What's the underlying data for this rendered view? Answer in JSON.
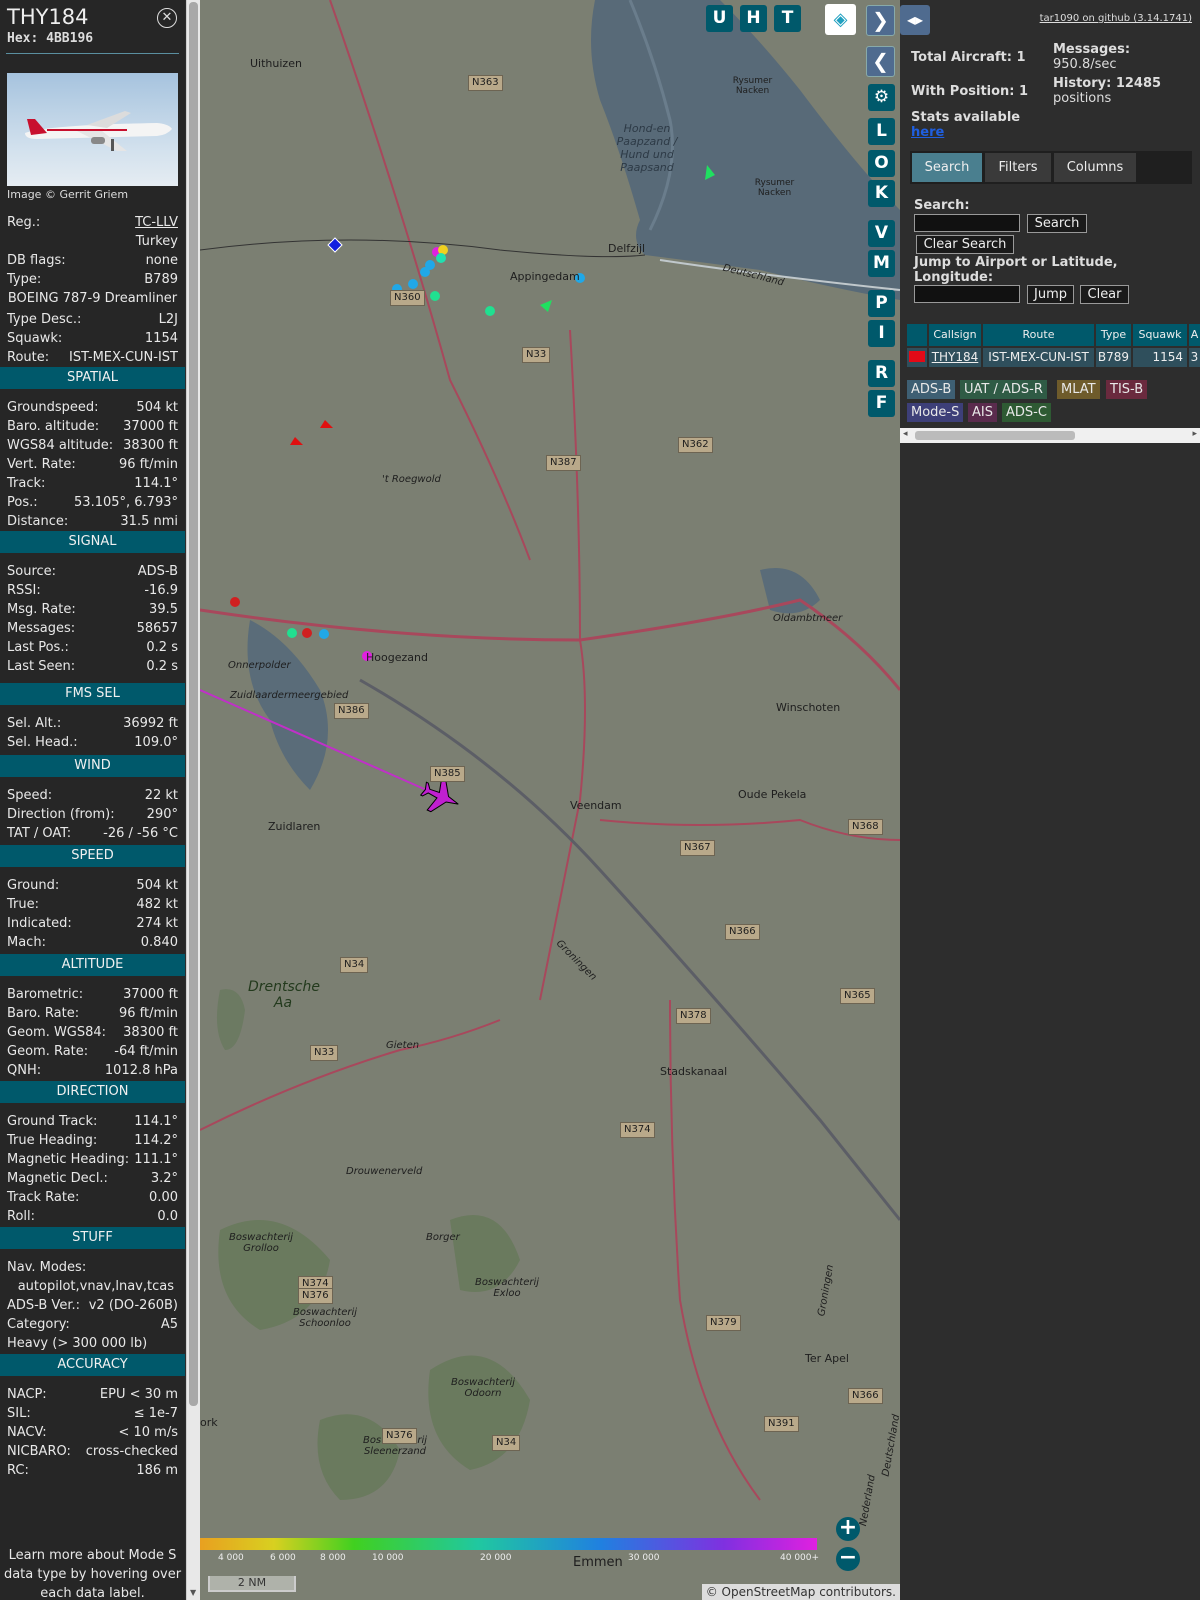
{
  "aircraft": {
    "callsign": "THY184",
    "hex": "Hex: 4BB196",
    "photo_credit": "Image © Gerrit Griem"
  },
  "basic": [
    {
      "k": "Reg.:",
      "v": "TC-LLV"
    },
    {
      "k": "",
      "v": "Turkey"
    },
    {
      "k": "DB flags:",
      "v": "none"
    },
    {
      "k": "Type:",
      "v": "B789"
    },
    {
      "k": "",
      "v": "BOEING 787-9 Dreamliner",
      "full": true
    },
    {
      "k": "Type Desc.:",
      "v": "L2J"
    },
    {
      "k": "Squawk:",
      "v": "1154"
    },
    {
      "k": "Route:",
      "v": "IST-MEX-CUN-IST"
    }
  ],
  "sections": [
    {
      "title": "SPATIAL",
      "rows": [
        {
          "k": "Groundspeed:",
          "v": "504 kt"
        },
        {
          "k": "Baro. altitude:",
          "v": "37000 ft"
        },
        {
          "k": "WGS84 altitude:",
          "v": "38300 ft"
        },
        {
          "k": "Vert. Rate:",
          "v": "96 ft/min"
        },
        {
          "k": "Track:",
          "v": "114.1°"
        },
        {
          "k": "Pos.:",
          "v": "53.105°, 6.793°"
        },
        {
          "k": "Distance:",
          "v": "31.5 nmi"
        }
      ]
    },
    {
      "title": "SIGNAL",
      "rows": [
        {
          "k": "Source:",
          "v": "ADS-B"
        },
        {
          "k": "RSSI:",
          "v": "-16.9"
        },
        {
          "k": "Msg. Rate:",
          "v": "39.5"
        },
        {
          "k": "Messages:",
          "v": "58657"
        },
        {
          "k": "Last Pos.:",
          "v": "0.2 s"
        },
        {
          "k": "Last Seen:",
          "v": "0.2 s"
        }
      ]
    },
    {
      "title": "FMS SEL",
      "rows": [
        {
          "k": "Sel. Alt.:",
          "v": "36992 ft"
        },
        {
          "k": "Sel. Head.:",
          "v": "109.0°"
        }
      ]
    },
    {
      "title": "WIND",
      "rows": [
        {
          "k": "Speed:",
          "v": "22 kt"
        },
        {
          "k": "Direction (from):",
          "v": "290°"
        },
        {
          "k": "TAT / OAT:",
          "v": "-26 / -56 °C"
        }
      ]
    },
    {
      "title": "SPEED",
      "rows": [
        {
          "k": "Ground:",
          "v": "504 kt"
        },
        {
          "k": "True:",
          "v": "482 kt"
        },
        {
          "k": "Indicated:",
          "v": "274 kt"
        },
        {
          "k": "Mach:",
          "v": "0.840"
        }
      ]
    },
    {
      "title": "ALTITUDE",
      "rows": [
        {
          "k": "Barometric:",
          "v": "37000 ft"
        },
        {
          "k": "Baro. Rate:",
          "v": "96 ft/min"
        },
        {
          "k": "Geom. WGS84:",
          "v": "38300 ft"
        },
        {
          "k": "Geom. Rate:",
          "v": "-64 ft/min"
        },
        {
          "k": "QNH:",
          "v": "1012.8 hPa"
        }
      ]
    },
    {
      "title": "DIRECTION",
      "rows": [
        {
          "k": "Ground Track:",
          "v": "114.1°"
        },
        {
          "k": "True Heading:",
          "v": "114.2°"
        },
        {
          "k": "Magnetic Heading:",
          "v": "111.1°"
        },
        {
          "k": "Magnetic Decl.:",
          "v": "3.2°"
        },
        {
          "k": "Track Rate:",
          "v": "0.00"
        },
        {
          "k": "Roll:",
          "v": "0.0"
        }
      ]
    },
    {
      "title": "STUFF",
      "rows": [
        {
          "k": "Nav. Modes:",
          "v": ""
        },
        {
          "k": "",
          "v": "autopilot,vnav,lnav,tcas"
        },
        {
          "k": "ADS-B Ver.:",
          "v": "v2 (DO-260B)"
        },
        {
          "k": "Category:",
          "v": "A5"
        },
        {
          "k": "Heavy (> 300 000 lb)",
          "v": ""
        }
      ]
    },
    {
      "title": "ACCURACY",
      "rows": [
        {
          "k": "NACP:",
          "v": "EPU < 30 m"
        },
        {
          "k": "SIL:",
          "v": "≤ 1e-7"
        },
        {
          "k": "NACV:",
          "v": "< 10 m/s"
        },
        {
          "k": "NICBARO:",
          "v": "cross-checked"
        },
        {
          "k": "RC:",
          "v": "186 m"
        }
      ]
    }
  ],
  "note": [
    "Learn more about Mode S",
    "data type by hovering over",
    "each data label."
  ],
  "map": {
    "top_buttons": [
      "U",
      "H",
      "T"
    ],
    "side_buttons": [
      "L",
      "O",
      "K",
      "V",
      "M",
      "P",
      "I",
      "R",
      "F"
    ],
    "places": [
      "Uithuizen",
      "Appingedam",
      "Delfzijl",
      "Hond-en Paapzand / Hund und Paapsand",
      "Rysumer Nacken",
      "Rysumer Nacken",
      "Deutschland",
      "'t Roegwold",
      "Onnerpolder",
      "Zuidlaardermeergebied",
      "Hoogezand",
      "Oldambtmeer",
      "Winschoten",
      "Veendam",
      "Oude Pekela",
      "Zuidlaren",
      "Drentsche Aa",
      "Gieten",
      "Stadskanaal",
      "Drouwenerveld",
      "Borger",
      "Boswachterij Grolloo",
      "Boswachterij Schoonloo",
      "Boswachterij Exloo",
      "Boswachterij Odoorn",
      "Boswachterij Sleenerzand",
      "Ter Apel",
      "Emmen",
      "Groningen",
      "Groningen",
      "Deutschland",
      "Nederland",
      "ork"
    ],
    "roads": [
      "N363",
      "N360",
      "N33",
      "N387",
      "N362",
      "N386",
      "N385",
      "N367",
      "N366",
      "N368",
      "N34",
      "N378",
      "N365",
      "N33",
      "N374",
      "N374",
      "N376",
      "N379",
      "N376",
      "N34",
      "N391",
      "N366"
    ],
    "scale_labels": [
      "4 000",
      "6 000",
      "8 000",
      "10 000",
      "20 000",
      "30 000",
      "40 000+"
    ],
    "scale_bar": "2 NM",
    "attribution": "© OpenStreetMap contributors.",
    "zoom_in": "+",
    "zoom_out": "−"
  },
  "right": {
    "github": "tar1090 on github (3.14.1741)",
    "total_aircraft": "Total Aircraft: 1",
    "with_position": "With Position: 1",
    "messages_label": "Messages:",
    "messages_value": "950.8/sec",
    "history_label": "History: 12485",
    "history_value": "positions",
    "stats_label": "Stats available",
    "stats_link": "here",
    "tabs": [
      "Search",
      "Filters",
      "Columns"
    ],
    "search_label": "Search:",
    "search_button": "Search",
    "clear_search": "Clear Search",
    "jump_label": "Jump to Airport or Latitude, Longitude:",
    "jump_button": "Jump",
    "clear_button": "Clear",
    "columns": [
      "Callsign",
      "Route",
      "Type",
      "Squawk",
      "A"
    ],
    "row": {
      "callsign": "THY184",
      "route": "IST-MEX-CUN-IST",
      "type": "B789",
      "squawk": "1154",
      "alt": "3"
    },
    "sources": [
      {
        "label": "ADS-B",
        "color": "#3e5f73"
      },
      {
        "label": "UAT / ADS-R",
        "color": "#2f5b45"
      },
      {
        "label": "MLAT",
        "color": "#6e5b2b"
      },
      {
        "label": "TIS-B",
        "color": "#6a2a3e"
      },
      {
        "label": "Mode-S",
        "color": "#3d3f78"
      },
      {
        "label": "AIS",
        "color": "#5a2b4d"
      },
      {
        "label": "ADS-C",
        "color": "#2e5a33"
      }
    ]
  }
}
